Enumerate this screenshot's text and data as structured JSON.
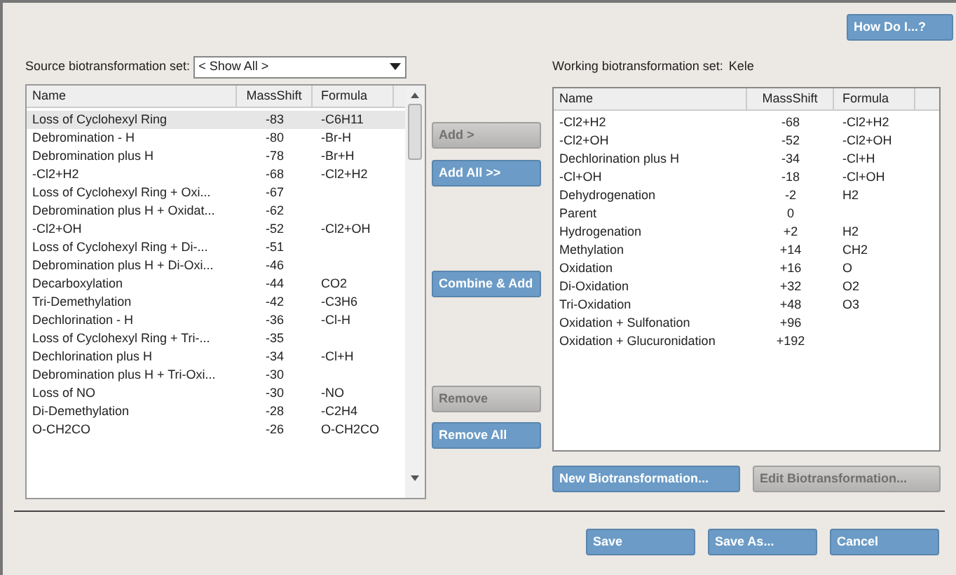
{
  "help_button": {
    "label": "How Do I...?",
    "disabled": false
  },
  "source": {
    "label": "Source biotransformation set:",
    "dropdown_value": "< Show All >",
    "columns": [
      "Name",
      "MassShift",
      "Formula"
    ],
    "rows": [
      {
        "cells": [
          "Loss of Cyclohexyl Ring",
          "-83",
          "-C6H11"
        ],
        "selected": true
      },
      {
        "cells": [
          "Debromination - H",
          "-80",
          "-Br-H"
        ],
        "selected": false
      },
      {
        "cells": [
          "Debromination plus H",
          "-78",
          "-Br+H"
        ],
        "selected": false
      },
      {
        "cells": [
          "-Cl2+H2",
          "-68",
          "-Cl2+H2"
        ],
        "selected": false
      },
      {
        "cells": [
          "Loss of Cyclohexyl Ring + Oxi...",
          "-67",
          ""
        ],
        "selected": false
      },
      {
        "cells": [
          "Debromination plus H + Oxidat...",
          "-62",
          ""
        ],
        "selected": false
      },
      {
        "cells": [
          "-Cl2+OH",
          "-52",
          "-Cl2+OH"
        ],
        "selected": false
      },
      {
        "cells": [
          "Loss of Cyclohexyl Ring + Di-...",
          "-51",
          ""
        ],
        "selected": false
      },
      {
        "cells": [
          "Debromination plus H + Di-Oxi...",
          "-46",
          ""
        ],
        "selected": false
      },
      {
        "cells": [
          "Decarboxylation",
          "-44",
          "CO2"
        ],
        "selected": false
      },
      {
        "cells": [
          "Tri-Demethylation",
          "-42",
          "-C3H6"
        ],
        "selected": false
      },
      {
        "cells": [
          "Dechlorination - H",
          "-36",
          "-Cl-H"
        ],
        "selected": false
      },
      {
        "cells": [
          "Loss of Cyclohexyl Ring + Tri-...",
          "-35",
          ""
        ],
        "selected": false
      },
      {
        "cells": [
          "Dechlorination plus H",
          "-34",
          "-Cl+H"
        ],
        "selected": false
      },
      {
        "cells": [
          "Debromination plus H + Tri-Oxi...",
          "-30",
          ""
        ],
        "selected": false
      },
      {
        "cells": [
          "Loss of NO",
          "-30",
          "-NO"
        ],
        "selected": false
      },
      {
        "cells": [
          "Di-Demethylation",
          "-28",
          "-C2H4"
        ],
        "selected": false
      },
      {
        "cells": [
          "O-CH2CO",
          "-26",
          "O-CH2CO"
        ],
        "selected": false
      }
    ]
  },
  "middle_buttons": [
    {
      "label": "Add >",
      "disabled": true
    },
    {
      "label": "Add All >>",
      "disabled": false
    },
    {
      "label": "Combine & Add",
      "disabled": false
    },
    {
      "label": "Remove",
      "disabled": true
    },
    {
      "label": "Remove All",
      "disabled": false
    }
  ],
  "working": {
    "label": "Working biotransformation set:",
    "set_name": "Kele",
    "columns": [
      "Name",
      "MassShift",
      "Formula"
    ],
    "rows": [
      {
        "cells": [
          "-Cl2+H2",
          "-68",
          "-Cl2+H2"
        ]
      },
      {
        "cells": [
          "-Cl2+OH",
          "-52",
          "-Cl2+OH"
        ]
      },
      {
        "cells": [
          "Dechlorination plus H",
          "-34",
          "-Cl+H"
        ]
      },
      {
        "cells": [
          "-Cl+OH",
          "-18",
          "-Cl+OH"
        ]
      },
      {
        "cells": [
          "Dehydrogenation",
          "-2",
          "H2"
        ]
      },
      {
        "cells": [
          "Parent",
          "0",
          ""
        ]
      },
      {
        "cells": [
          "Hydrogenation",
          "+2",
          "H2"
        ]
      },
      {
        "cells": [
          "Methylation",
          "+14",
          "CH2"
        ]
      },
      {
        "cells": [
          "Oxidation",
          "+16",
          "O"
        ]
      },
      {
        "cells": [
          "Di-Oxidation",
          "+32",
          "O2"
        ]
      },
      {
        "cells": [
          "Tri-Oxidation",
          "+48",
          "O3"
        ]
      },
      {
        "cells": [
          "Oxidation + Sulfonation",
          "+96",
          ""
        ]
      },
      {
        "cells": [
          "Oxidation + Glucuronidation",
          "+192",
          ""
        ]
      }
    ]
  },
  "edit_buttons": [
    {
      "label": "New Biotransformation...",
      "disabled": false
    },
    {
      "label": "Edit Biotransformation...",
      "disabled": true
    }
  ],
  "footer_buttons": [
    {
      "label": "Save",
      "disabled": false
    },
    {
      "label": "Save As...",
      "disabled": false
    },
    {
      "label": "Cancel",
      "disabled": false
    }
  ]
}
